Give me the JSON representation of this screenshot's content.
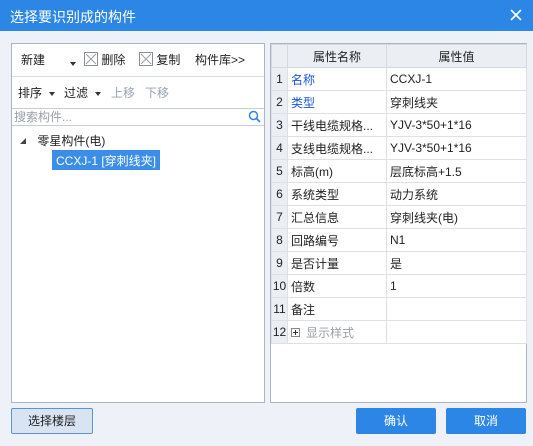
{
  "dialog": {
    "title": "选择要识别成的构件"
  },
  "toolbar1": {
    "new_label": "新建",
    "delete_label": "删除",
    "copy_label": "复制",
    "library_label": "构件库>>"
  },
  "toolbar2": {
    "sort_label": "排序",
    "filter_label": "过滤",
    "move_up_label": "上移",
    "move_down_label": "下移"
  },
  "search": {
    "placeholder": "搜索构件..."
  },
  "tree": {
    "root_label": "零星构件(电)",
    "selected_child_label": "CCXJ-1 [穿刺线夹]"
  },
  "properties": {
    "headers": {
      "name": "属性名称",
      "value": "属性值"
    },
    "rows": [
      {
        "index": "1",
        "name": "名称",
        "value": "CCXJ-1"
      },
      {
        "index": "2",
        "name": "类型",
        "value": "穿刺线夹"
      },
      {
        "index": "3",
        "name": "干线电缆规格...",
        "value": "YJV-3*50+1*16"
      },
      {
        "index": "4",
        "name": "支线电缆规格...",
        "value": "YJV-3*50+1*16"
      },
      {
        "index": "5",
        "name": "标高(m)",
        "value": "层底标高+1.5"
      },
      {
        "index": "6",
        "name": "系统类型",
        "value": "动力系统"
      },
      {
        "index": "7",
        "name": "汇总信息",
        "value": "穿刺线夹(电)"
      },
      {
        "index": "8",
        "name": "回路编号",
        "value": "N1"
      },
      {
        "index": "9",
        "name": "是否计量",
        "value": "是"
      },
      {
        "index": "10",
        "name": "倍数",
        "value": "1"
      },
      {
        "index": "11",
        "name": "备注",
        "value": ""
      },
      {
        "index": "12",
        "name": "显示样式",
        "value": ""
      }
    ]
  },
  "footer": {
    "select_floor_label": "选择楼层",
    "ok_label": "确认",
    "cancel_label": "取消"
  },
  "colors": {
    "accent": "#2c86e6",
    "selected_bg": "#3a8ee8",
    "link_text": "#1a56d6",
    "body_bg": "#eef2f8"
  },
  "icons": [
    "close-icon",
    "dropdown-arrow-icon",
    "checkbox-icon",
    "search-icon",
    "tree-expand-icon",
    "plus-expand-icon"
  ]
}
